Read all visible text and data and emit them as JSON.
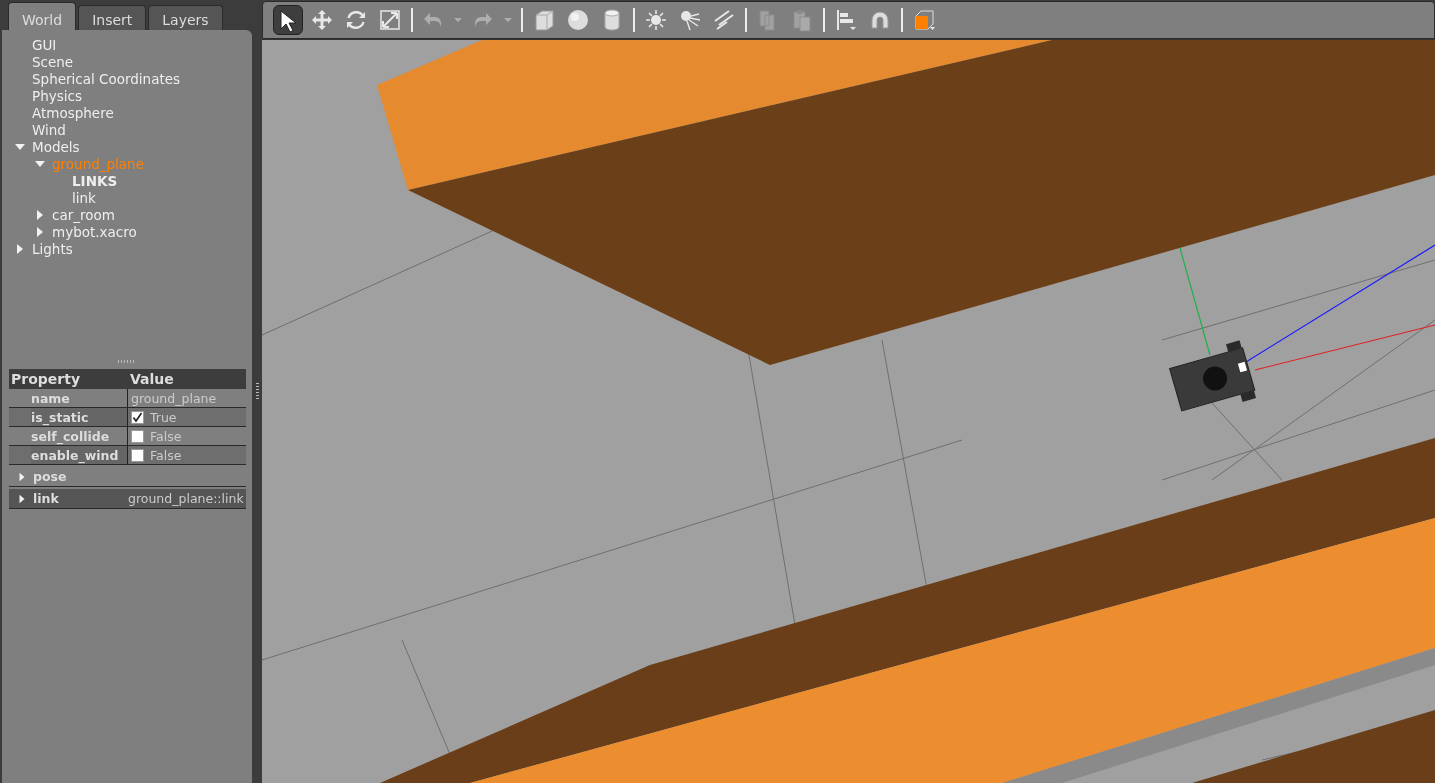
{
  "tabs": [
    {
      "label": "World",
      "selected": true
    },
    {
      "label": "Insert",
      "selected": false
    },
    {
      "label": "Layers",
      "selected": false
    }
  ],
  "tree": [
    {
      "label": "GUI"
    },
    {
      "label": "Scene"
    },
    {
      "label": "Spherical Coordinates"
    },
    {
      "label": "Physics"
    },
    {
      "label": "Atmosphere"
    },
    {
      "label": "Wind"
    },
    {
      "label": "Models",
      "expanded": true,
      "children": [
        {
          "label": "ground_plane",
          "expanded": true,
          "selected": true,
          "children": [
            {
              "label": "LINKS",
              "kind": "heading"
            },
            {
              "label": "link"
            }
          ]
        },
        {
          "label": "car_room",
          "expanded": false
        },
        {
          "label": "mybot.xacro",
          "expanded": false
        }
      ]
    },
    {
      "label": "Lights",
      "expanded": false
    }
  ],
  "properties": {
    "columns": [
      "Property",
      "Value"
    ],
    "rows": [
      {
        "kind": "text",
        "name": "name",
        "value": "ground_plane"
      },
      {
        "kind": "checkbox",
        "name": "is_static",
        "checked": true,
        "value": "True"
      },
      {
        "kind": "checkbox",
        "name": "self_collide",
        "checked": false,
        "value": "False"
      },
      {
        "kind": "checkbox",
        "name": "enable_wind",
        "checked": false,
        "value": "False"
      },
      {
        "kind": "group",
        "name": "pose",
        "expanded": false
      },
      {
        "kind": "group",
        "name": "link",
        "expanded": false,
        "value": "ground_plane::link"
      }
    ]
  },
  "toolbar": [
    {
      "kind": "tool",
      "selected": true
    },
    {
      "kind": "tool",
      "selected": false
    },
    {
      "kind": "tool",
      "selected": false
    },
    {
      "kind": "tool",
      "selected": false
    },
    {
      "kind": "sep"
    },
    {
      "kind": "tool",
      "disabled": true
    },
    {
      "kind": "tool",
      "disabled": true
    },
    {
      "kind": "sep"
    },
    {
      "kind": "tool",
      "selected": false
    },
    {
      "kind": "tool",
      "selected": false
    },
    {
      "kind": "tool",
      "selected": false
    },
    {
      "kind": "sep"
    },
    {
      "kind": "tool",
      "selected": false
    },
    {
      "kind": "tool",
      "selected": false
    },
    {
      "kind": "tool",
      "selected": false
    },
    {
      "kind": "sep"
    },
    {
      "kind": "tool",
      "disabled": true
    },
    {
      "kind": "tool",
      "disabled": true
    },
    {
      "kind": "sep"
    },
    {
      "kind": "tool",
      "selected": false
    },
    {
      "kind": "tool",
      "selected": false
    },
    {
      "kind": "sep"
    },
    {
      "kind": "tool",
      "selected": false
    }
  ]
}
